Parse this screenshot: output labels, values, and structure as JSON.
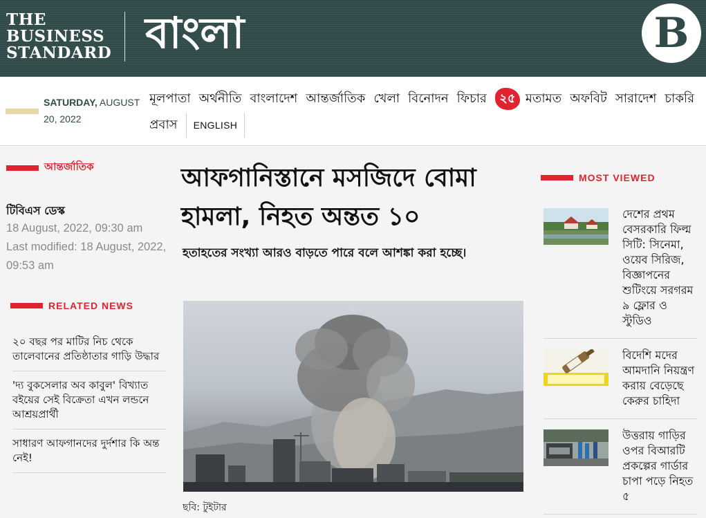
{
  "header": {
    "brand_en": [
      "THE",
      "BUSINESS",
      "STANDARD"
    ],
    "brand_bn": "বাংলা",
    "badge_letter": "B",
    "colors": {
      "masthead": "#2f4a48",
      "accent_red": "#e0232f"
    }
  },
  "nav": {
    "date_day": "SATURDAY,",
    "date_rest": "AUGUST 20, 2022",
    "items_row1": [
      "মূলপাতা",
      "অর্থনীতি",
      "বাংলাদেশ",
      "আন্তর্জাতিক",
      "খেলা",
      "বিনোদন",
      "ফিচার"
    ],
    "emblem": "২৫",
    "items_row1b": [
      "মতামত",
      "অফবিট",
      "সারাদেশ",
      "চাকরি"
    ],
    "items_row2": [
      "প্রবাস"
    ],
    "english": "ENGLISH"
  },
  "article": {
    "section": "আন্তর্জাতিক",
    "author": "টিবিএস ডেস্ক",
    "published": "18 August, 2022, 09:30 am",
    "modified": "Last modified: 18 August, 2022, 09:53 am",
    "headline": "আফগানিস্তানে মসজিদে বোমা হামলা, নিহত অন্তত ১০",
    "subhead": "হতাহতের সংখ্যা আরও বাড়তে পারে বলে আশঙ্কা করা হচ্ছে।",
    "caption": "ছবি: টুইটার"
  },
  "related": {
    "heading": "RELATED NEWS",
    "items": [
      "২০ বছর পর মাটির নিচ থেকে তালেবানের প্রতিষ্ঠাতার গাড়ি উদ্ধার",
      "'দ্য বুকসেলার অব কাবুল' বিখ্যাত বইয়ের সেই বিক্রেতা এখন লন্ডনে আশ্রয়প্রার্থী",
      "সাধারণ আফগানদের দুর্দশার কি অন্ত নেই!"
    ]
  },
  "most_viewed": {
    "heading": "MOST VIEWED",
    "items": [
      "দেশের প্রথম বেসরকারি ফিল্ম সিটি: সিনেমা, ওয়েব সিরিজ, বিজ্ঞাপনের শুটিংয়ে সরগরম ৯ ফ্লোর ও স্টুডিও",
      "বিদেশি মদের আমদানি নিয়ন্ত্রণ করায় বেড়েছে কেরুর চাহিদা",
      "উত্তরায় গাড়ির ওপর বিআরটি প্রকল্পের গার্ডার চাপা পড়ে নিহত ৫"
    ]
  }
}
